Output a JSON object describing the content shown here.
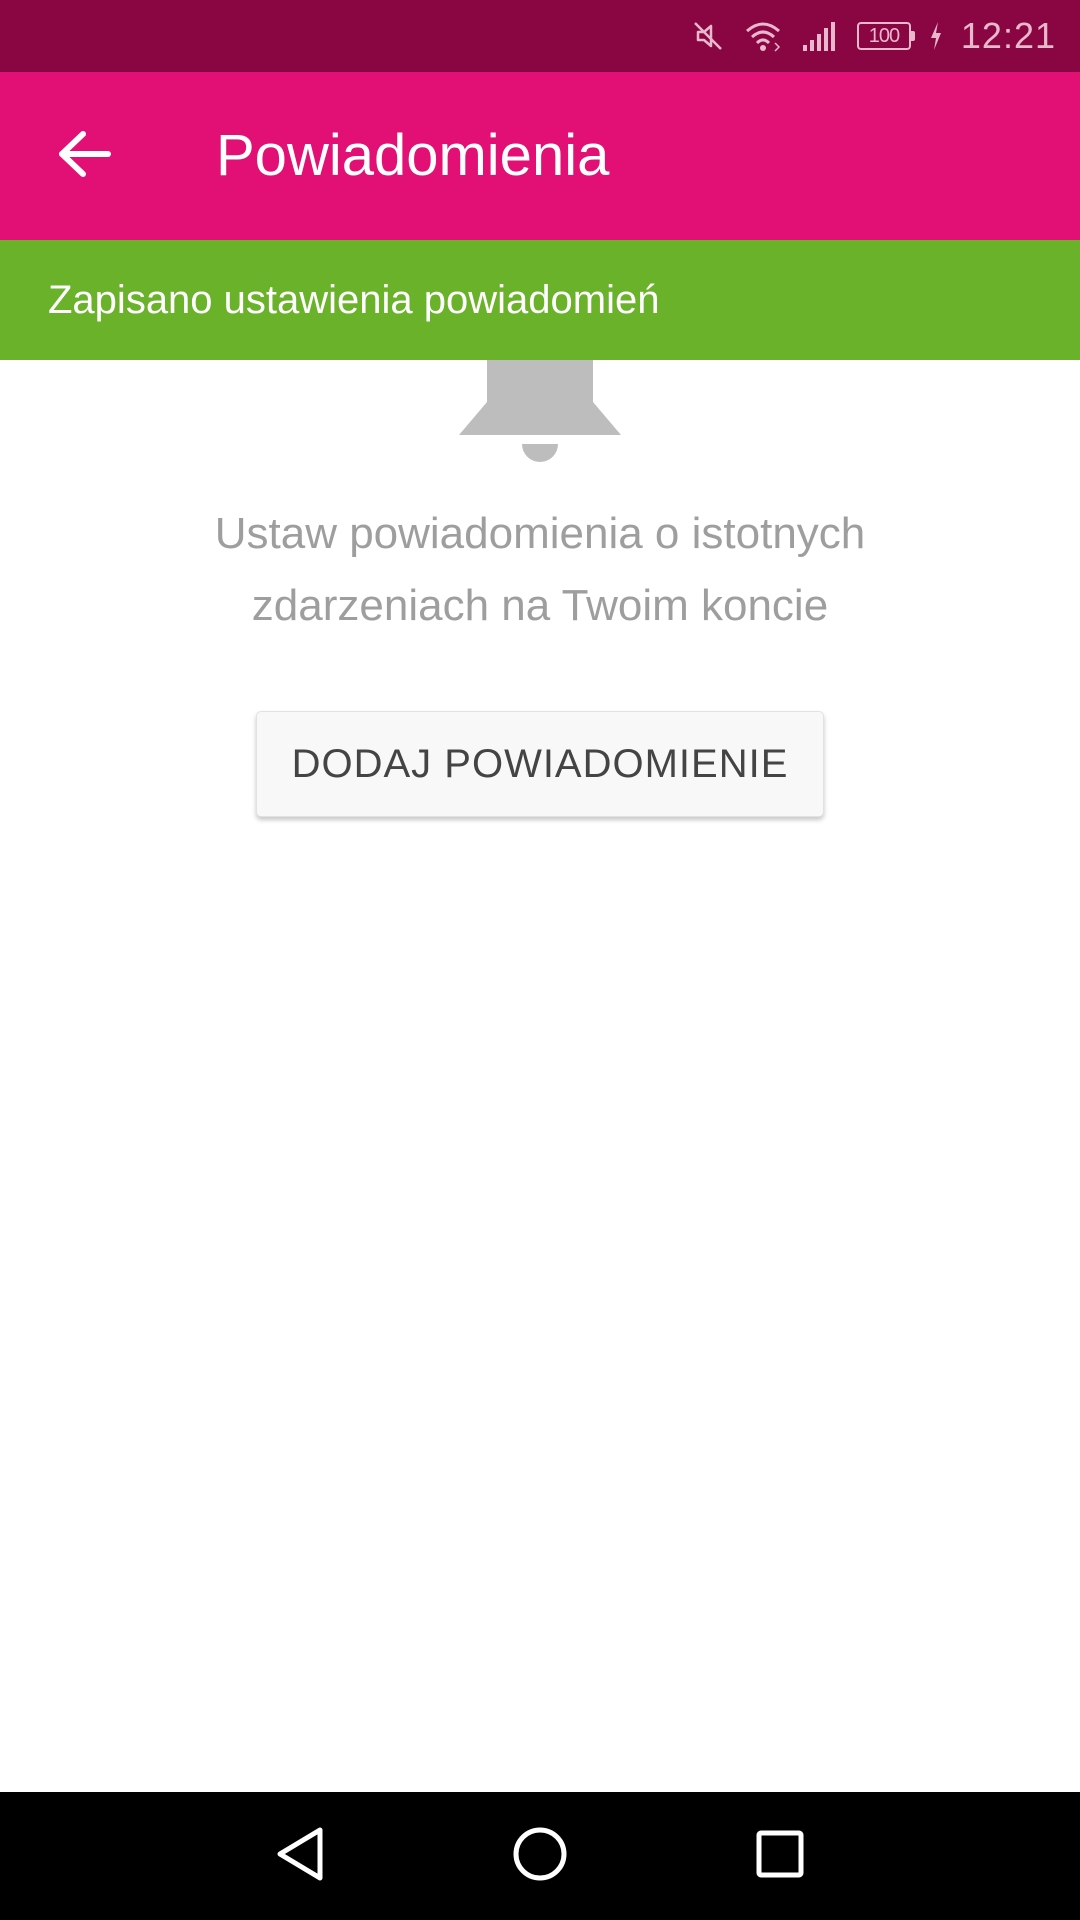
{
  "status_bar": {
    "time": "12:21",
    "battery_level": "100",
    "icons": [
      "mute-icon",
      "wifi-icon",
      "signal-icon",
      "battery-icon",
      "charging-icon"
    ]
  },
  "app_bar": {
    "title": "Powiadomienia",
    "back_icon": "arrow-left-icon"
  },
  "banner": {
    "message": "Zapisano ustawienia powiadomień",
    "color": "#6ab22a"
  },
  "empty_state": {
    "icon": "bell-icon",
    "message": "Ustaw powiadomienia o istotnych zdarzeniach na Twoim koncie",
    "button_label": "DODAJ POWIADOMIENIE"
  },
  "nav_bar": {
    "icons": [
      "back-triangle-icon",
      "home-circle-icon",
      "recents-square-icon"
    ]
  },
  "colors": {
    "status_bar": "#8a0642",
    "app_bar": "#e20f74",
    "banner": "#6ab22a",
    "text_muted": "#9e9e9e"
  }
}
